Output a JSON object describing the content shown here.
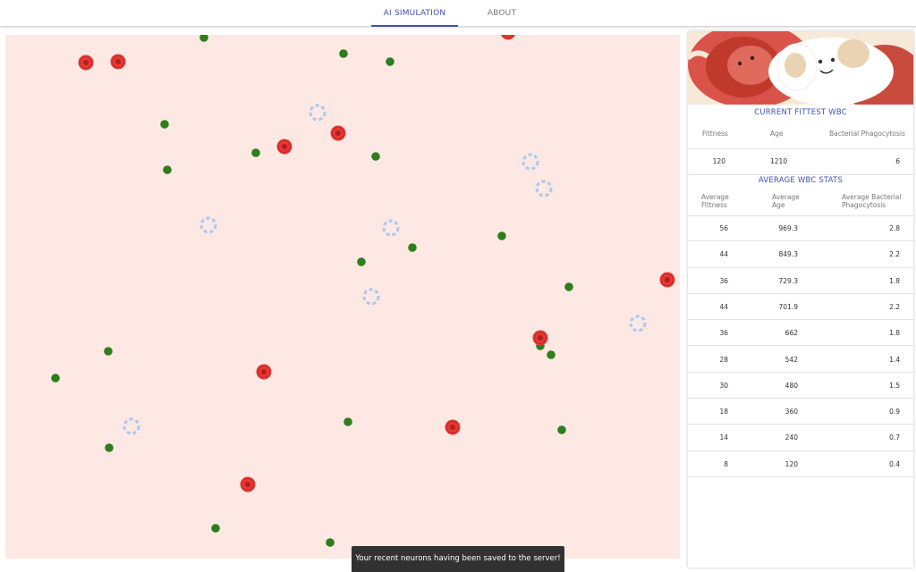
{
  "nav": {
    "tabs": [
      {
        "label": "AI SIMULATION"
      },
      {
        "label": "ABOUT"
      }
    ]
  },
  "colors": {
    "accent": "#3f51b5",
    "arena_bg": "#fde8e4",
    "bacteria": "#2e7d1e",
    "red_cell": "#e53935",
    "wbc_ring": "#a7c8f2"
  },
  "fittest": {
    "title": "CURRENT FITTEST WBC",
    "headers": {
      "fitness": "Fittness",
      "age": "Age",
      "phago": "Bacterial Phagocytosis"
    },
    "values": {
      "fitness": "120",
      "age": "1210",
      "phago": "6"
    }
  },
  "average": {
    "title": "AVERAGE WBC STATS",
    "headers": {
      "fitness": "Average Fittness",
      "age": "Average Age",
      "phago": "Average Bacterial Phagocytosis"
    },
    "rows": [
      {
        "fitness": "56",
        "age": "969.3",
        "phago": "2.8"
      },
      {
        "fitness": "44",
        "age": "849.3",
        "phago": "2.2"
      },
      {
        "fitness": "36",
        "age": "729.3",
        "phago": "1.8"
      },
      {
        "fitness": "44",
        "age": "701.9",
        "phago": "2.2"
      },
      {
        "fitness": "36",
        "age": "662",
        "phago": "1.8"
      },
      {
        "fitness": "28",
        "age": "542",
        "phago": "1.4"
      },
      {
        "fitness": "30",
        "age": "480",
        "phago": "1.5"
      },
      {
        "fitness": "18",
        "age": "360",
        "phago": "0.9"
      },
      {
        "fitness": "14",
        "age": "240",
        "phago": "0.7"
      },
      {
        "fitness": "8",
        "age": "120",
        "phago": "0.4"
      }
    ]
  },
  "toast": {
    "message": "Your recent neurons having been saved to the server!"
  }
}
